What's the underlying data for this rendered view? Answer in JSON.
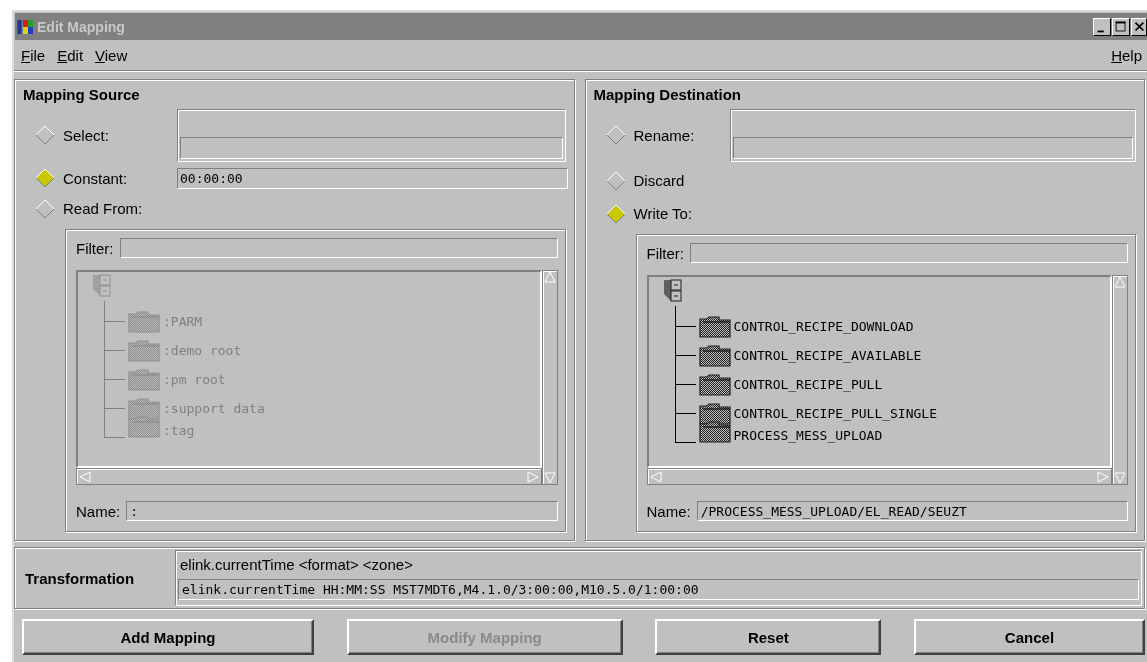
{
  "window": {
    "title": "Edit Mapping"
  },
  "menu": {
    "left": [
      {
        "label": "File"
      },
      {
        "label": "Edit"
      },
      {
        "label": "View"
      }
    ],
    "right": [
      {
        "label": "Help"
      }
    ]
  },
  "source": {
    "title": "Mapping Source",
    "options": [
      {
        "label": "Select:",
        "selected": false,
        "kind": "combo"
      },
      {
        "label": "Constant:",
        "selected": true,
        "kind": "text",
        "value": "00:00:00"
      },
      {
        "label": "Read From:",
        "selected": false,
        "kind": "browser"
      }
    ],
    "browser": {
      "disabled": true,
      "filter_label": "Filter:",
      "name_label": "Name:",
      "name_value": ":",
      "tree": {
        "children": [
          {
            "label": ":PARM"
          },
          {
            "label": ":demo root"
          },
          {
            "label": ":pm root"
          },
          {
            "label": ":support data"
          },
          {
            "label": ":tag"
          }
        ]
      }
    }
  },
  "destination": {
    "title": "Mapping Destination",
    "options": [
      {
        "label": "Rename:",
        "selected": false,
        "kind": "combo"
      },
      {
        "label": "Discard",
        "selected": false,
        "kind": "plain"
      },
      {
        "label": "Write To:",
        "selected": true,
        "kind": "browser"
      }
    ],
    "browser": {
      "disabled": false,
      "filter_label": "Filter:",
      "name_label": "Name:",
      "name_value": "/PROCESS_MESS_UPLOAD/EL_READ/SEUZT",
      "tree": {
        "children": [
          {
            "label": "CONTROL_RECIPE_DOWNLOAD"
          },
          {
            "label": "CONTROL_RECIPE_AVAILABLE"
          },
          {
            "label": "CONTROL_RECIPE_PULL"
          },
          {
            "label": "CONTROL_RECIPE_PULL_SINGLE"
          },
          {
            "label": "PROCESS_MESS_UPLOAD"
          }
        ]
      }
    }
  },
  "transformation": {
    "label": "Transformation",
    "expression": "elink.currentTime <format> <zone>",
    "value": "elink.currentTime HH:MM:SS MST7MDT6,M4.1.0/3:00:00,M10.5.0/1:00:00"
  },
  "buttons": [
    {
      "label": "Add Mapping",
      "disabled": false
    },
    {
      "label": "Modify Mapping",
      "disabled": true
    },
    {
      "label": "Reset",
      "disabled": false
    },
    {
      "label": "Cancel",
      "disabled": false
    }
  ]
}
